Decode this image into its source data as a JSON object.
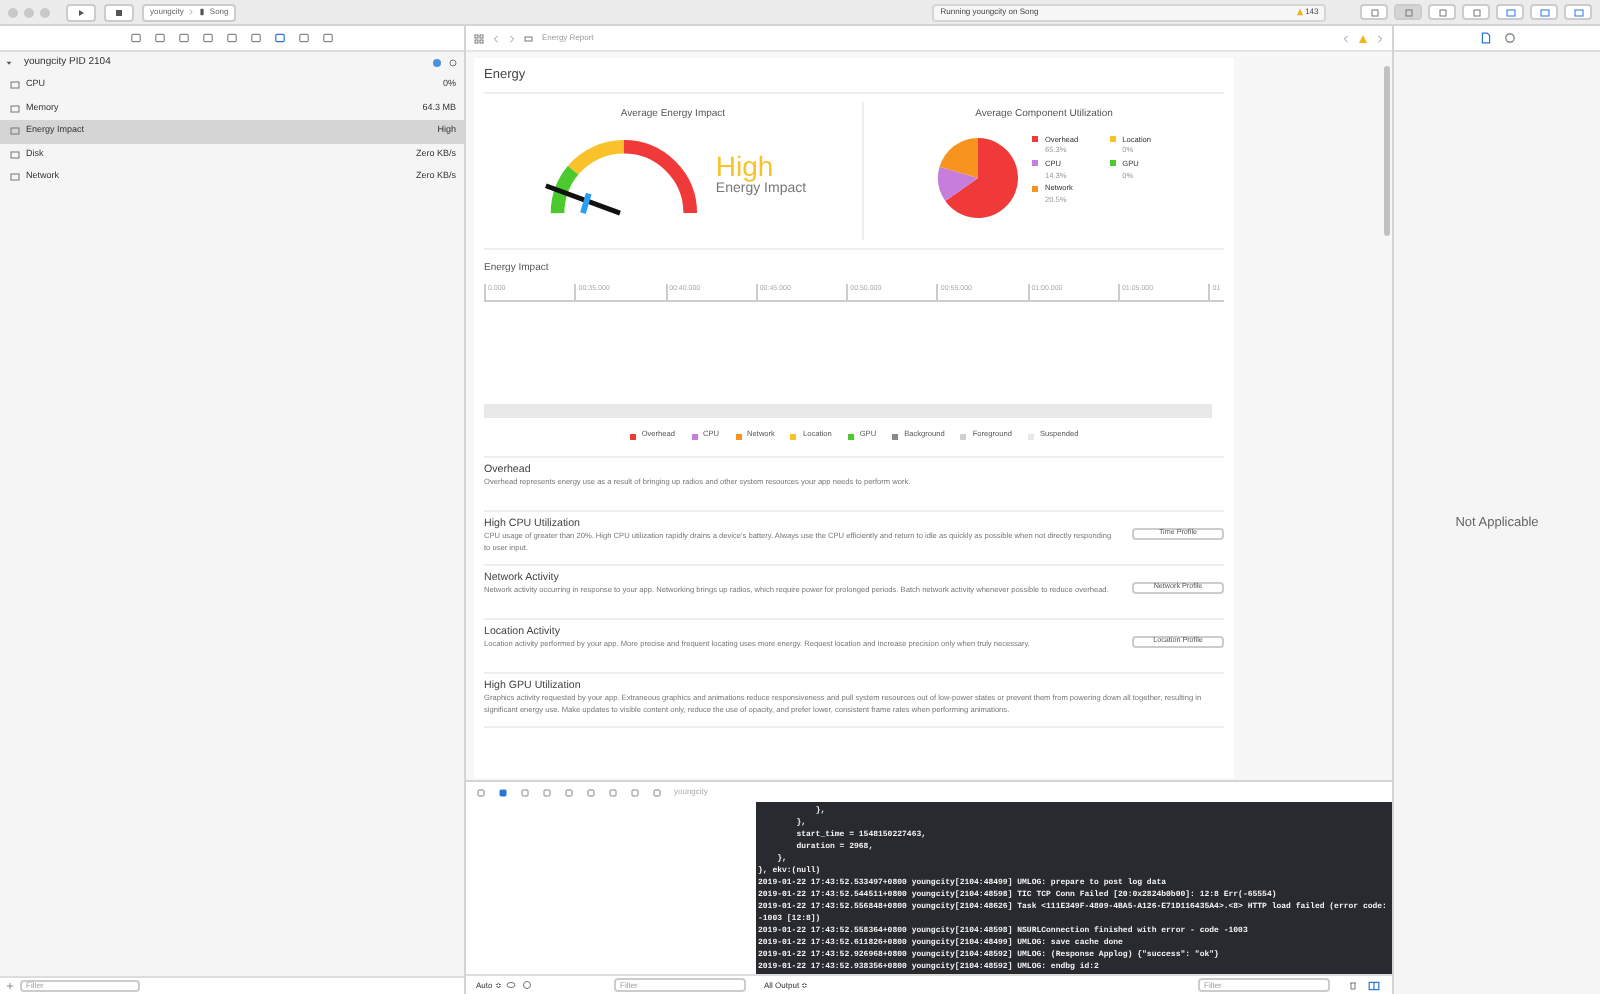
{
  "toolbar": {
    "scheme": "youngcity",
    "device": "Song",
    "status": "Running youngcity on Song",
    "warnings": "143"
  },
  "navigator": {
    "process": "youngcity PID 2104",
    "items": [
      {
        "label": "CPU",
        "value": "0%",
        "selected": false
      },
      {
        "label": "Memory",
        "value": "64.3 MB",
        "selected": false
      },
      {
        "label": "Energy Impact",
        "value": "High",
        "selected": true
      },
      {
        "label": "Disk",
        "value": "Zero KB/s",
        "selected": false
      },
      {
        "label": "Network",
        "value": "Zero KB/s",
        "selected": false
      }
    ]
  },
  "jump_bar": {
    "title": "Energy Report"
  },
  "energy": {
    "title": "Energy",
    "impact": {
      "title": "Average Energy Impact",
      "rating": "High",
      "caption": "Energy Impact"
    },
    "components": {
      "title": "Average Component Utilization",
      "legend": [
        {
          "label": "Overhead",
          "value": "65.3%",
          "color": "#f03a3a"
        },
        {
          "label": "CPU",
          "value": "14.3%",
          "color": "#c77ddb"
        },
        {
          "label": "Network",
          "value": "20.5%",
          "color": "#f7931e"
        },
        {
          "label": "Location",
          "value": "0%",
          "color": "#f9c22b"
        },
        {
          "label": "GPU",
          "value": "0%",
          "color": "#4cc92d"
        }
      ]
    },
    "timeline": {
      "title": "Energy Impact",
      "ticks": [
        "0.000",
        "00:35.000",
        "00:40.000",
        "00:45.000",
        "00:50.000",
        "00:55.000",
        "01:00.000",
        "01:05.000",
        "01"
      ],
      "legend": [
        {
          "label": "Overhead",
          "color": "#f03a3a"
        },
        {
          "label": "CPU",
          "color": "#c77ddb"
        },
        {
          "label": "Network",
          "color": "#f7931e"
        },
        {
          "label": "Location",
          "color": "#f9c22b"
        },
        {
          "label": "GPU",
          "color": "#4cc92d"
        },
        {
          "label": "Background",
          "color": "#8a8a8a"
        },
        {
          "label": "Foreground",
          "color": "#cfcfcf"
        },
        {
          "label": "Suspended",
          "color": "#e8e8e8"
        }
      ]
    },
    "sections": [
      {
        "title": "Overhead",
        "text": "Overhead represents energy use as a result of bringing up radios and other system resources your app needs to perform work."
      },
      {
        "title": "High CPU Utilization",
        "text": "CPU usage of greater than 20%. High CPU utilization rapidly drains a device's battery.  Always use the CPU efficiently and return to idle as quickly as possible when not directly responding to user input.",
        "button": "Time Profile"
      },
      {
        "title": "Network Activity",
        "text": "Network activity occurring in response to your app. Networking brings up radios, which require power for prolonged periods. Batch network activity whenever possible to reduce overhead.",
        "button": "Network Profile"
      },
      {
        "title": "Location Activity",
        "text": "Location activity performed by your app. More precise and frequent locating uses more energy. Request location and increase precision only when truly necessary.",
        "button": "Location Profile"
      },
      {
        "title": "High GPU Utilization",
        "text": "Graphics activity requested by your app. Extraneous graphics and animations reduce responsiveness and pull system resources out of low-power states or prevent them from powering down all together, resulting in significant energy use. Make updates to visible content only, reduce the use of opacity, and prefer lower, consistent frame rates when performing animations."
      }
    ]
  },
  "inspector": {
    "message": "Not Applicable"
  },
  "debug_bar": {
    "target": "youngcity"
  },
  "console": {
    "lines": [
      "            },",
      "        },",
      "        start_time = 1548150227463,",
      "        duration = 2968,",
      "    },",
      "}, ekv:(null)",
      "2019-01-22 17:43:52.533497+0800 youngcity[2104:48499] UMLOG: prepare to post log data",
      "2019-01-22 17:43:52.544511+0800 youngcity[2104:48598] TIC TCP Conn Failed [20:0x2824b0b00]: 12:8 Err(-65554)",
      "2019-01-22 17:43:52.556848+0800 youngcity[2104:48626] Task <111E349F-4809-4BA5-A126-E71D116435A4>.<8> HTTP load failed (error code: -1003 [12:8])",
      "2019-01-22 17:43:52.558364+0800 youngcity[2104:48598] NSURLConnection finished with error - code -1003",
      "2019-01-22 17:43:52.611826+0800 youngcity[2104:48499] UMLOG: save cache done",
      "2019-01-22 17:43:52.926968+0800 youngcity[2104:48592] UMLOG: (Response Applog) {\"success\": \"ok\"}",
      "2019-01-22 17:43:52.938356+0800 youngcity[2104:48592] UMLOG: endbg id:2"
    ]
  },
  "footer": {
    "navigator_filter_placeholder": "Filter",
    "variables_mode": "Auto ≎",
    "filter_placeholder": "Filter",
    "output_mode": "All Output ≎",
    "console_filter_placeholder": "Filter"
  }
}
